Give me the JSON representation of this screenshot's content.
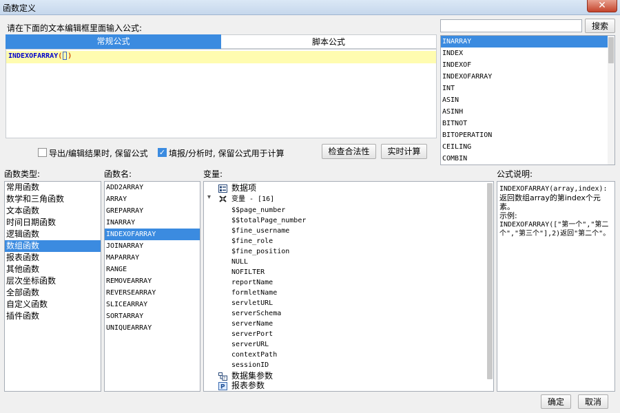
{
  "window": {
    "title": "函数定义",
    "close_label": "✕"
  },
  "editor": {
    "instruction": "请在下面的文本编辑框里面输入公式:",
    "tabs": [
      {
        "label": "常规公式"
      },
      {
        "label": "脚本公式"
      }
    ],
    "formula_name": "INDEXOFARRAY",
    "formula_open": "(",
    "formula_close": ")"
  },
  "search": {
    "value": "",
    "button_label": "搜索"
  },
  "function_list": {
    "items": [
      "INARRAY",
      "INDEX",
      "INDEXOF",
      "INDEXOFARRAY",
      "INT",
      "ASIN",
      "ASINH",
      "BITNOT",
      "BITOPERATION",
      "CEILING",
      "COMBIN"
    ],
    "selected": 0
  },
  "options": {
    "export_keep": {
      "label": "导出/编辑结果时, 保留公式",
      "checked": false
    },
    "fill_keep": {
      "label": "填报/分析时, 保留公式用于计算",
      "checked": true
    },
    "check_button": "检查合法性",
    "realtime_button": "实时计算"
  },
  "categories": {
    "header": "函数类型:",
    "items": [
      "常用函数",
      "数学和三角函数",
      "文本函数",
      "时间日期函数",
      "逻辑函数",
      "数组函数",
      "报表函数",
      "其他函数",
      "层次坐标函数",
      "全部函数",
      "自定义函数",
      "插件函数"
    ],
    "selected": 5
  },
  "functions": {
    "header": "函数名:",
    "items": [
      "ADD2ARRAY",
      "ARRAY",
      "GREPARRAY",
      "INARRAY",
      "INDEXOFARRAY",
      "JOINARRAY",
      "MAPARRAY",
      "RANGE",
      "REMOVEARRAY",
      "REVERSEARRAY",
      "SLICEARRAY",
      "SORTARRAY",
      "UNIQUEARRAY"
    ],
    "selected": 4
  },
  "variables": {
    "header": "变量:",
    "data_item": "数据项",
    "var_group": "变量 - [16]",
    "vars": [
      "$$page_number",
      "$$totalPage_number",
      "$fine_username",
      "$fine_role",
      "$fine_position",
      "NULL",
      "NOFILTER",
      "reportName",
      "formletName",
      "servletURL",
      "serverSchema",
      "serverName",
      "serverPort",
      "serverURL",
      "contextPath",
      "sessionID"
    ],
    "dataset_params": "数据集参数",
    "report_params": "报表参数",
    "icon_p_letter": "P",
    "icon_names": {
      "data_item": "data-item-icon",
      "var_group": "variable-group-icon",
      "dataset": "dataset-param-icon",
      "report": "report-param-icon"
    }
  },
  "description": {
    "header": "公式说明:",
    "signature": "INDEXOFARRAY(array,index):",
    "line1": "返回数组array的第index个元素。",
    "example_label": "示例:",
    "example": "INDEXOFARRAY([\"第一个\",\"第二个\",\"第三个\"],2)返回\"第二个\"。"
  },
  "footer": {
    "ok": "确定",
    "cancel": "取消"
  },
  "colors": {
    "selection": "#3b8be0",
    "formula_highlight": "#fffcb0",
    "formula_text": "#0000cc"
  }
}
